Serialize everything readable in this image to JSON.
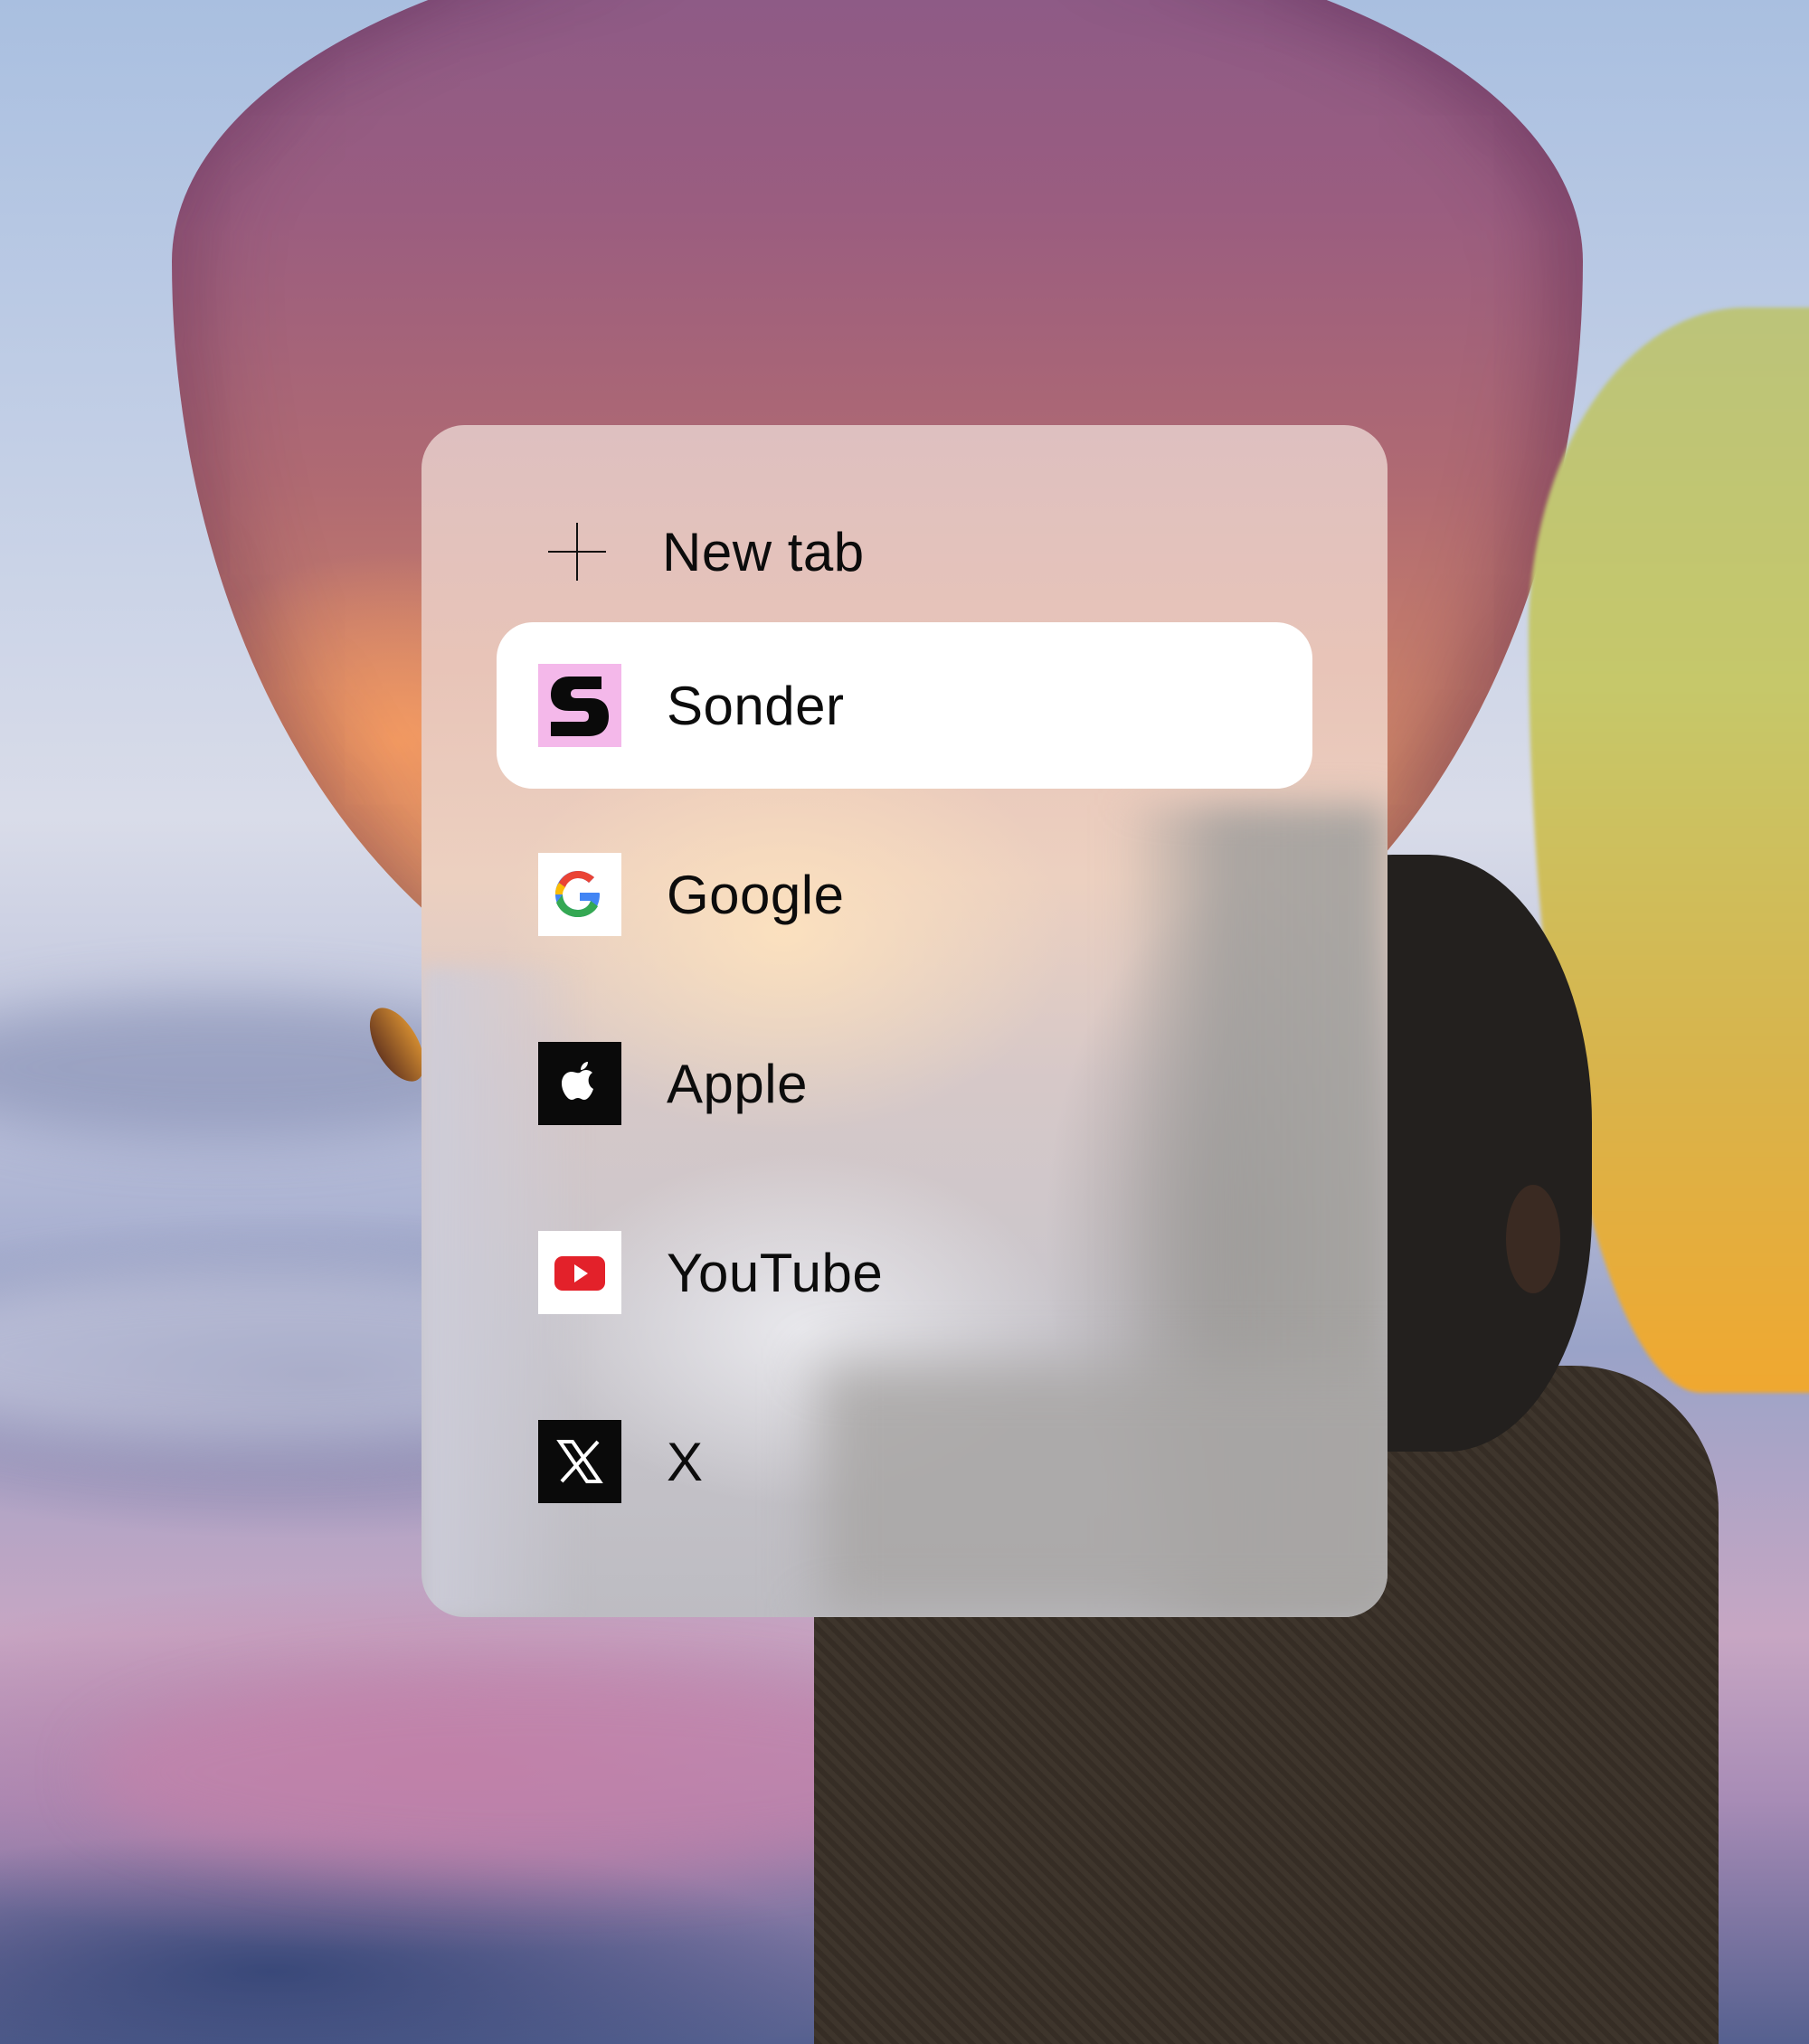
{
  "new_tab": {
    "label": "New tab",
    "icon": "plus-icon"
  },
  "tabs": [
    {
      "label": "Sonder",
      "icon": "sonder-logo-icon",
      "active": true,
      "icon_bg": "#f4b8ea"
    },
    {
      "label": "Google",
      "icon": "google-logo-icon",
      "active": false,
      "icon_bg": "#ffffff"
    },
    {
      "label": "Apple",
      "icon": "apple-logo-icon",
      "active": false,
      "icon_bg": "#0a0a0a"
    },
    {
      "label": "YouTube",
      "icon": "youtube-logo-icon",
      "active": false,
      "icon_bg": "#ffffff"
    },
    {
      "label": "X",
      "icon": "x-logo-icon",
      "active": false,
      "icon_bg": "#0a0a0a"
    }
  ],
  "colors": {
    "active_tab_bg": "#ffffff",
    "text": "#0c0c0c",
    "youtube_red": "#e3212a"
  }
}
